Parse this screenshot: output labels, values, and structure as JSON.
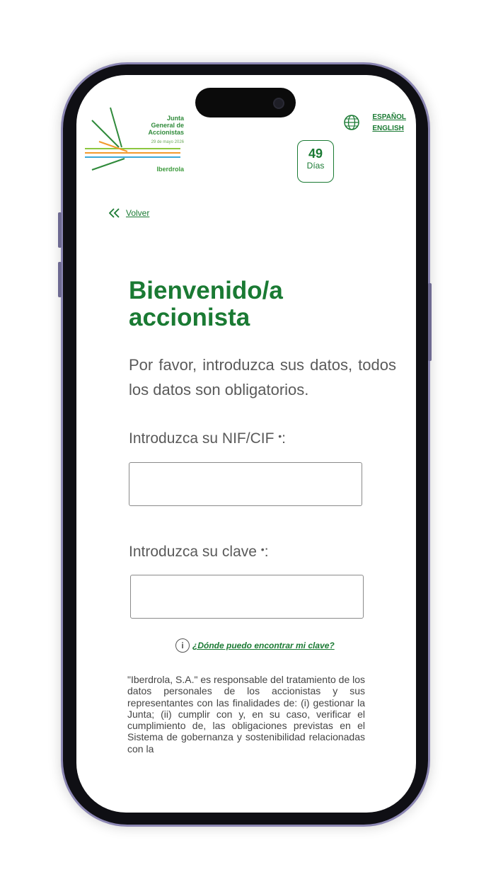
{
  "event": {
    "line1": "Junta",
    "line2": "General de",
    "line3": "Accionistas",
    "date": "29 de mayo 2026",
    "brand": "Iberdrola"
  },
  "languages": [
    "ESPAÑOL",
    "ENGLISH"
  ],
  "countdown": {
    "number": "49",
    "label": "Días"
  },
  "back_label": "Volver",
  "title": "Bienvenido/a accionista",
  "subtitle": "Por favor, introduzca sus datos, todos los datos son obligatorios.",
  "fields": {
    "nif_label": "Introduzca su NIF/CIF",
    "key_label": "Introduzca su clave",
    "required_mark": "•",
    "colon": ":"
  },
  "help_link": "¿Dónde puedo encontrar mi clave?",
  "legal_text": "\"Iberdrola, S.A.\" es responsable del tratamiento de los datos personales de los accionistas y sus representantes con las finalidades de: (i) gestionar la Junta; (ii) cumplir con y, en su caso, verificar el cumplimiento de, las obligaciones previstas en el Sistema de gobernanza y sostenibilidad relacionadas con la",
  "colors": {
    "brand_green": "#1a7a33",
    "text_gray": "#5a5a5a",
    "frame_purple": "#8b86b3"
  }
}
